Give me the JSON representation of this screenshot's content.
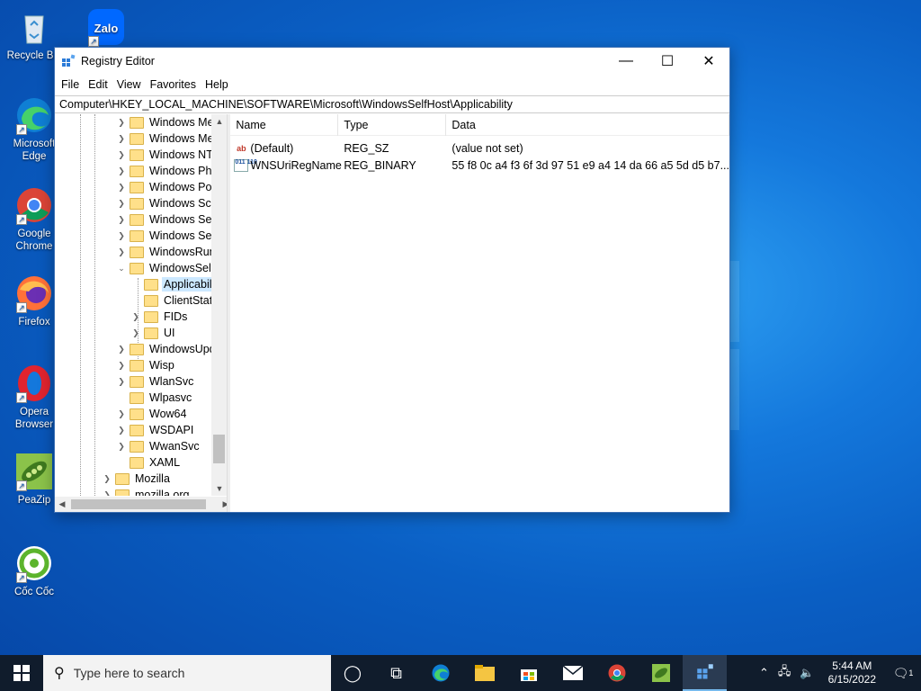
{
  "desktop": {
    "icons": [
      {
        "label": "Recycle Bin"
      },
      {
        "label": "Zalo"
      },
      {
        "label": "Microsoft Edge"
      },
      {
        "label": "Google Chrome"
      },
      {
        "label": "Firefox"
      },
      {
        "label": "Opera Browser"
      },
      {
        "label": "PeaZip"
      },
      {
        "label": "Cốc Cốc"
      }
    ]
  },
  "window": {
    "title": "Registry Editor",
    "controls": {
      "minimize": "—",
      "maximize": "☐",
      "close": "✕"
    },
    "menu": [
      "File",
      "Edit",
      "View",
      "Favorites",
      "Help"
    ],
    "address": "Computer\\HKEY_LOCAL_MACHINE\\SOFTWARE\\Microsoft\\WindowsSelfHost\\Applicability",
    "tree": [
      {
        "label": "Windows Media F"
      },
      {
        "label": "Windows Messag"
      },
      {
        "label": "Windows NT"
      },
      {
        "label": "Windows Photo V"
      },
      {
        "label": "Windows Portabl"
      },
      {
        "label": "Windows Script H"
      },
      {
        "label": "Windows Search"
      },
      {
        "label": "Windows Security"
      },
      {
        "label": "WindowsRuntime"
      },
      {
        "label": "WindowsSelfHost"
      },
      {
        "label": "Applicability"
      },
      {
        "label": "ClientState"
      },
      {
        "label": "FIDs"
      },
      {
        "label": "UI"
      },
      {
        "label": "WindowsUpdate"
      },
      {
        "label": "Wisp"
      },
      {
        "label": "WlanSvc"
      },
      {
        "label": "Wlpasvc"
      },
      {
        "label": "Wow64"
      },
      {
        "label": "WSDAPI"
      },
      {
        "label": "WwanSvc"
      },
      {
        "label": "XAML"
      },
      {
        "label": "Mozilla"
      },
      {
        "label": "mozilla.org"
      }
    ],
    "columns": {
      "name": "Name",
      "type": "Type",
      "data": "Data"
    },
    "values": [
      {
        "icon": "ab",
        "name": "(Default)",
        "type": "REG_SZ",
        "data": "(value not set)"
      },
      {
        "icon": "011 110",
        "name": "WNSUriRegName",
        "type": "REG_BINARY",
        "data": "55 f8 0c a4 f3 6f 3d 97 51 e9 a4 14 da 66 a5 5d d5 b7..."
      }
    ]
  },
  "taskbar": {
    "search_placeholder": "Type here to search",
    "time": "5:44 AM",
    "date": "6/15/2022",
    "notification_count": "1"
  }
}
